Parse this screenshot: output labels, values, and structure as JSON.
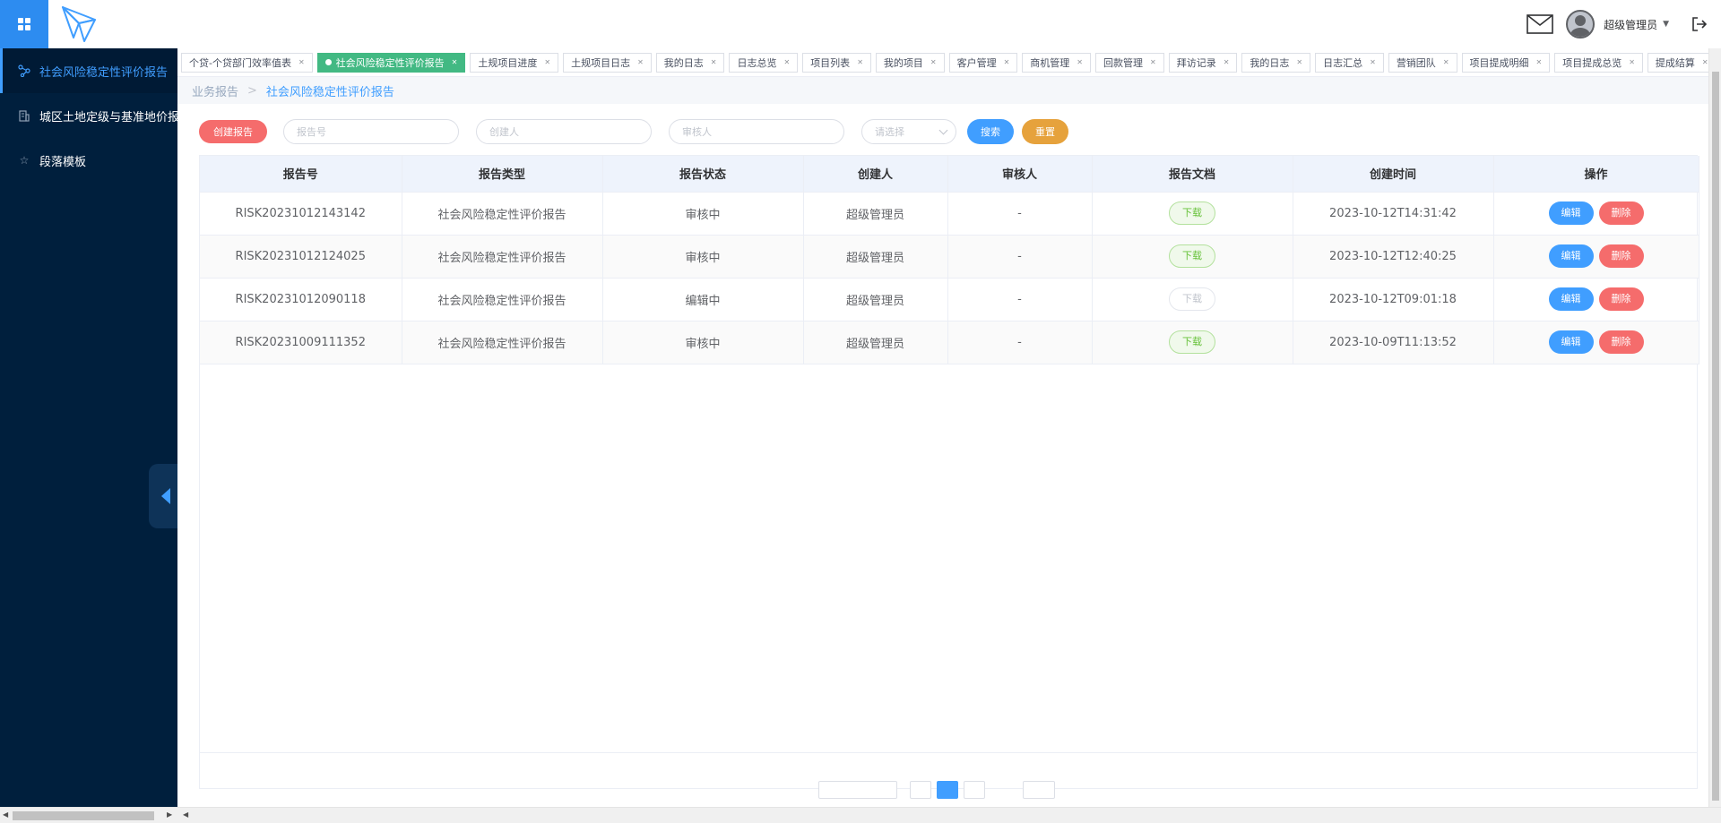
{
  "header": {
    "username": "超级管理员"
  },
  "sidebar": {
    "items": [
      {
        "label": "社会风险稳定性评价报告",
        "icon": "share-icon",
        "active": true
      },
      {
        "label": "城区土地定级与基准地价报",
        "icon": "building-icon",
        "active": false
      },
      {
        "label": "段落模板",
        "icon": "star-icon",
        "active": false
      }
    ]
  },
  "tabs": [
    {
      "label": "个贷-个贷部门效率值表",
      "active": false
    },
    {
      "label": "社会风险稳定性评价报告",
      "active": true
    },
    {
      "label": "土规项目进度",
      "active": false
    },
    {
      "label": "土规项目日志",
      "active": false
    },
    {
      "label": "我的日志",
      "active": false
    },
    {
      "label": "日志总览",
      "active": false
    },
    {
      "label": "项目列表",
      "active": false
    },
    {
      "label": "我的项目",
      "active": false
    },
    {
      "label": "客户管理",
      "active": false
    },
    {
      "label": "商机管理",
      "active": false
    },
    {
      "label": "回款管理",
      "active": false
    },
    {
      "label": "拜访记录",
      "active": false
    },
    {
      "label": "我的日志",
      "active": false
    },
    {
      "label": "日志汇总",
      "active": false
    },
    {
      "label": "营销团队",
      "active": false
    },
    {
      "label": "项目提成明细",
      "active": false
    },
    {
      "label": "项目提成总览",
      "active": false
    },
    {
      "label": "提成结算",
      "active": false
    }
  ],
  "breadcrumb": {
    "parent": "业务报告",
    "separator": ">",
    "current": "社会风险稳定性评价报告"
  },
  "filters": {
    "create_label": "创建报告",
    "report_no_placeholder": "报告号",
    "creator_placeholder": "创建人",
    "reviewer_placeholder": "审核人",
    "status_placeholder": "请选择",
    "search_label": "搜索",
    "reset_label": "重置"
  },
  "table": {
    "columns": [
      "报告号",
      "报告类型",
      "报告状态",
      "创建人",
      "审核人",
      "报告文档",
      "创建时间",
      "操作"
    ],
    "download_label": "下载",
    "edit_label": "编辑",
    "delete_label": "删除",
    "rows": [
      {
        "report_no": "RISK20231012143142",
        "type": "社会风险稳定性评价报告",
        "status": "审核中",
        "creator": "超级管理员",
        "reviewer": "-",
        "download_enabled": true,
        "created": "2023-10-12T14:31:42"
      },
      {
        "report_no": "RISK20231012124025",
        "type": "社会风险稳定性评价报告",
        "status": "审核中",
        "creator": "超级管理员",
        "reviewer": "-",
        "download_enabled": true,
        "created": "2023-10-12T12:40:25"
      },
      {
        "report_no": "RISK20231012090118",
        "type": "社会风险稳定性评价报告",
        "status": "编辑中",
        "creator": "超级管理员",
        "reviewer": "-",
        "download_enabled": false,
        "created": "2023-10-12T09:01:18"
      },
      {
        "report_no": "RISK20231009111352",
        "type": "社会风险稳定性评价报告",
        "status": "审核中",
        "creator": "超级管理员",
        "reviewer": "-",
        "download_enabled": true,
        "created": "2023-10-09T11:13:52"
      }
    ]
  },
  "colors": {
    "primary": "#409eff",
    "danger": "#f56c6c",
    "warning": "#e6a23c",
    "success": "#42b983",
    "sidebar_bg": "#001f3d"
  }
}
